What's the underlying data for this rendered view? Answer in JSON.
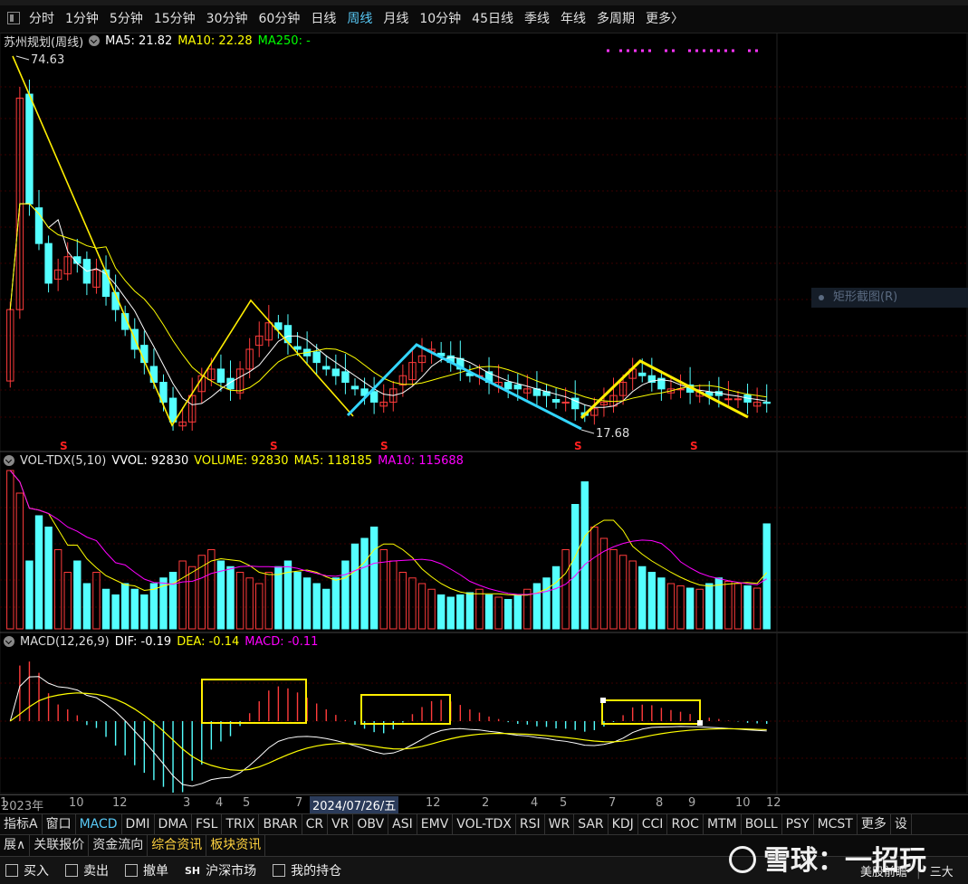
{
  "toolbar": {
    "periods": [
      "分时",
      "1分钟",
      "5分钟",
      "15分钟",
      "30分钟",
      "60分钟",
      "日线",
      "周线",
      "月线",
      "10分钟",
      "45日线",
      "季线",
      "年线",
      "多周期",
      "更多〉"
    ],
    "active": "周线"
  },
  "kline": {
    "name": "苏州规划(周线)",
    "ma5": "MA5: 21.82",
    "ma10": "MA10: 22.28",
    "ma250": "MA250: -",
    "max_label": "74.63",
    "min_label": "17.68",
    "s_marker": "S"
  },
  "vol": {
    "name": "VOL-TDX(5,10)",
    "vvol": "VVOL: 92830",
    "volume": "VOLUME: 92830",
    "ma5": "MA5: 118185",
    "ma10": "MA10: 115688"
  },
  "macd": {
    "name": "MACD(12,26,9)",
    "dif": "DIF: -0.19",
    "dea": "DEA: -0.14",
    "macd": "MACD: -0.11"
  },
  "context_menu": {
    "item": "矩形截图(R)"
  },
  "time_axis": {
    "labels": [
      "2023年",
      "10",
      "12",
      "3",
      "4",
      "5",
      "7",
      "2024/07/26/五",
      "12",
      "2",
      "4",
      "5",
      "7",
      "8",
      "9",
      "10",
      "12",
      "1"
    ]
  },
  "indicator_tabs": {
    "items": [
      "指标A",
      "窗口",
      "MACD",
      "DMI",
      "DMA",
      "FSL",
      "TRIX",
      "BRAR",
      "CR",
      "VR",
      "OBV",
      "ASI",
      "EMV",
      "VOL-TDX",
      "RSI",
      "WR",
      "SAR",
      "KDJ",
      "CCI",
      "ROC",
      "MTM",
      "BOLL",
      "PSY",
      "MCST",
      "更多",
      "设"
    ],
    "active": "MACD"
  },
  "info_tabs": {
    "items": [
      "展∧",
      "关联报价",
      "资金流向",
      "综合资讯",
      "板块资讯"
    ],
    "highlight": [
      "综合资讯",
      "板块资讯"
    ]
  },
  "bottom": {
    "buy": "买入",
    "sell": "卖出",
    "cancel": "撤单",
    "market_tag": "SH",
    "market": "沪深市场",
    "holdings": "我的持仓",
    "right1": "美股前瞻",
    "right2": "三大",
    "watermark": "雪球：一招玩"
  },
  "colors": {
    "up": "#ff3b3b",
    "down": "#54ffff",
    "ma5": "#ffffff",
    "ma10": "#ffff00",
    "ma250": "#00ff00",
    "vol_ma10": "#ff00ff",
    "annot_cyan": "#33d6ff",
    "annot_yellow": "#ffee00",
    "active_tab": "#58c8f5"
  },
  "chart_data": {
    "type": "candlestick",
    "title": "苏州规划(周线)",
    "kline": {
      "ylim": [
        17.68,
        74.63
      ],
      "close": [
        36,
        68,
        52,
        46,
        40,
        42,
        44,
        43,
        40,
        42,
        38,
        36,
        33,
        30,
        28,
        25,
        22,
        19,
        19,
        23,
        26,
        27,
        25,
        24,
        27,
        30,
        32,
        34,
        33,
        31,
        30,
        29,
        28,
        27,
        26,
        25,
        24,
        23,
        22,
        22,
        24,
        26,
        28,
        29,
        30,
        29,
        28,
        27,
        26,
        26,
        25,
        25,
        24,
        24,
        24,
        23,
        23,
        22,
        22,
        21,
        20,
        21,
        22,
        23,
        25,
        27,
        26,
        25,
        24,
        24,
        24,
        23.5,
        23.5,
        23,
        23,
        22.5,
        22.5,
        22,
        22,
        21.82
      ],
      "max": 74.63,
      "min": 17.68,
      "ma5_last": 21.82,
      "ma10_last": 22.28
    },
    "volume": {
      "values": [
        140,
        120,
        60,
        100,
        90,
        70,
        50,
        60,
        40,
        50,
        35,
        30,
        40,
        35,
        30,
        40,
        45,
        50,
        60,
        55,
        65,
        70,
        60,
        55,
        50,
        45,
        40,
        50,
        55,
        60,
        50,
        45,
        40,
        35,
        45,
        60,
        75,
        80,
        90,
        70,
        60,
        50,
        45,
        40,
        35,
        30,
        28,
        30,
        32,
        35,
        30,
        28,
        26,
        30,
        35,
        40,
        45,
        55,
        70,
        110,
        130,
        90,
        80,
        70,
        65,
        60,
        55,
        50,
        45,
        40,
        38,
        36,
        35,
        40,
        45,
        42,
        40,
        38,
        36,
        92.83
      ],
      "vvol_last": 92830,
      "ma5_last": 118185,
      "ma10_last": 115688
    },
    "macd": {
      "dif_last": -0.19,
      "dea_last": -0.14,
      "macd_last": -0.11
    }
  }
}
